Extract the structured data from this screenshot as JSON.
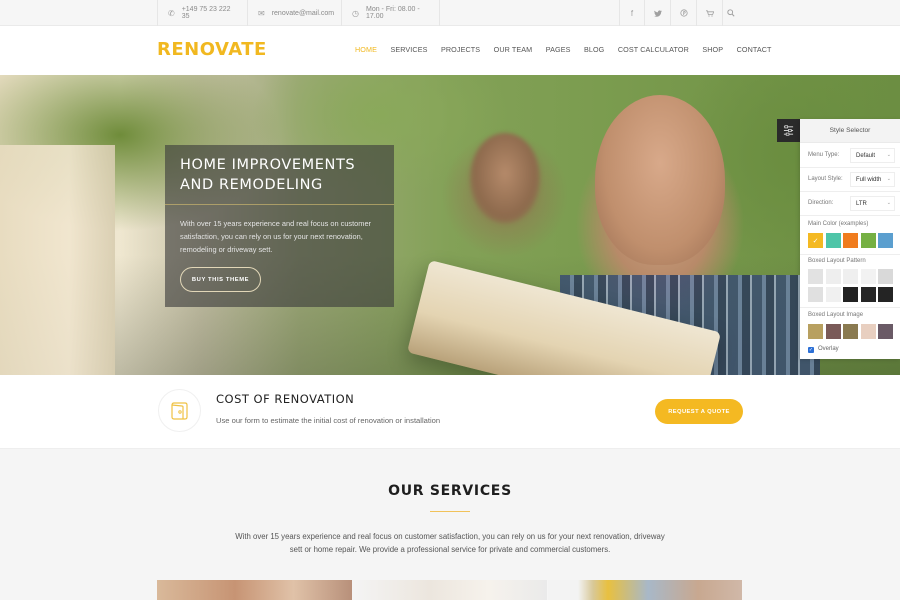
{
  "topbar": {
    "phone": "+149 75 23 222 35",
    "email": "renovate@mail.com",
    "hours": "Mon - Fri: 08.00 - 17.00",
    "icons": [
      "phone-icon",
      "envelope-icon",
      "clock-icon"
    ],
    "social": [
      {
        "name": "facebook-icon",
        "glyph": "f"
      },
      {
        "name": "twitter-icon",
        "glyph": "✉"
      },
      {
        "name": "pinterest-icon",
        "glyph": "Ⓟ"
      },
      {
        "name": "cart-icon",
        "glyph": "🛒"
      },
      {
        "name": "search-icon",
        "glyph": "⌕"
      }
    ]
  },
  "header": {
    "logo": "RENOVATE",
    "nav": [
      "HOME",
      "SERVICES",
      "PROJECTS",
      "OUR TEAM",
      "PAGES",
      "BLOG",
      "COST CALCULATOR",
      "SHOP",
      "CONTACT"
    ],
    "active": "HOME",
    "brand_color": "#f1b820"
  },
  "hero": {
    "title_line1": "HOME IMPROVEMENTS",
    "title_line2": "AND REMODELING",
    "text": "With over 15 years experience and real focus on customer satisfaction, you can rely on us for your next renovation, remodeling or driveway sett.",
    "button": "BUY THIS THEME"
  },
  "style_selector": {
    "title": "Style Selector",
    "menu_type_label": "Menu Type:",
    "menu_type_value": "Default",
    "layout_style_label": "Layout Style:",
    "layout_style_value": "Full width",
    "direction_label": "Direction:",
    "direction_value": "LTR",
    "main_color_label": "Main Color (examples)",
    "main_colors": [
      "#f4b922",
      "#4ec5a8",
      "#f07c1e",
      "#75b043",
      "#5b9fcf"
    ],
    "selected_color": "#f4b922",
    "pattern_label": "Boxed Layout Pattern",
    "patterns": [
      "#e2e2e2",
      "#eeeeee",
      "#efefef",
      "#f2f2f2",
      "#d9d9d9",
      "#e0e0e0",
      "#f0f0f0",
      "#222222",
      "#262626",
      "#242424"
    ],
    "image_label": "Boxed Layout Image",
    "images": [
      "#b8a060",
      "#7a5a58",
      "#8a7a50",
      "#e8cfc0",
      "#6a5a66"
    ],
    "overlay_label": "Overlay",
    "overlay_checked": true
  },
  "cost": {
    "title": "COST OF RENOVATION",
    "text": "Use our form to estimate the initial cost of renovation or installation",
    "button": "REQUEST A QUOTE"
  },
  "services": {
    "title": "OUR SERVICES",
    "text": "With over 15 years experience and real focus on customer satisfaction, you can rely on us for your next renovation, driveway sett or home repair. We provide a professional service for private and commercial customers."
  }
}
